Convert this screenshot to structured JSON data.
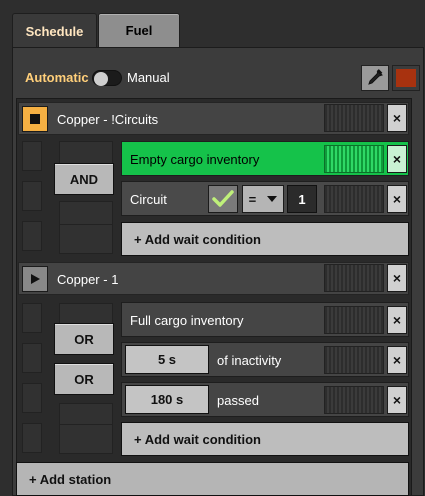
{
  "tabs": [
    {
      "label": "Schedule",
      "active": true
    },
    {
      "label": "Fuel",
      "active": false
    }
  ],
  "mode": {
    "automatic_label": "Automatic",
    "manual_label": "Manual"
  },
  "colors": {
    "accent": "#ffcf7a",
    "active_condition": "#15c24a",
    "train_color": "#a8320f",
    "station_stop": "#f5b043"
  },
  "stations": [
    {
      "name": "Copper - !Circuits",
      "state_icon": "stop-icon",
      "logic": [
        "AND"
      ],
      "conditions": [
        {
          "label": "Empty cargo inventory",
          "active": true
        },
        {
          "label": "Circuit",
          "compare": "=",
          "value": "1",
          "check_icon": "checkmark-icon"
        }
      ],
      "add_condition_label": "+ Add wait condition"
    },
    {
      "name": "Copper - 1",
      "state_icon": "play-icon",
      "logic": [
        "OR",
        "OR"
      ],
      "conditions": [
        {
          "label": "Full cargo inventory"
        },
        {
          "value": "5 s",
          "label": "of inactivity"
        },
        {
          "value": "180 s",
          "label": "passed"
        }
      ],
      "add_condition_label": "+ Add wait condition"
    }
  ],
  "add_station_label": "+ Add station",
  "close_glyph": "×"
}
